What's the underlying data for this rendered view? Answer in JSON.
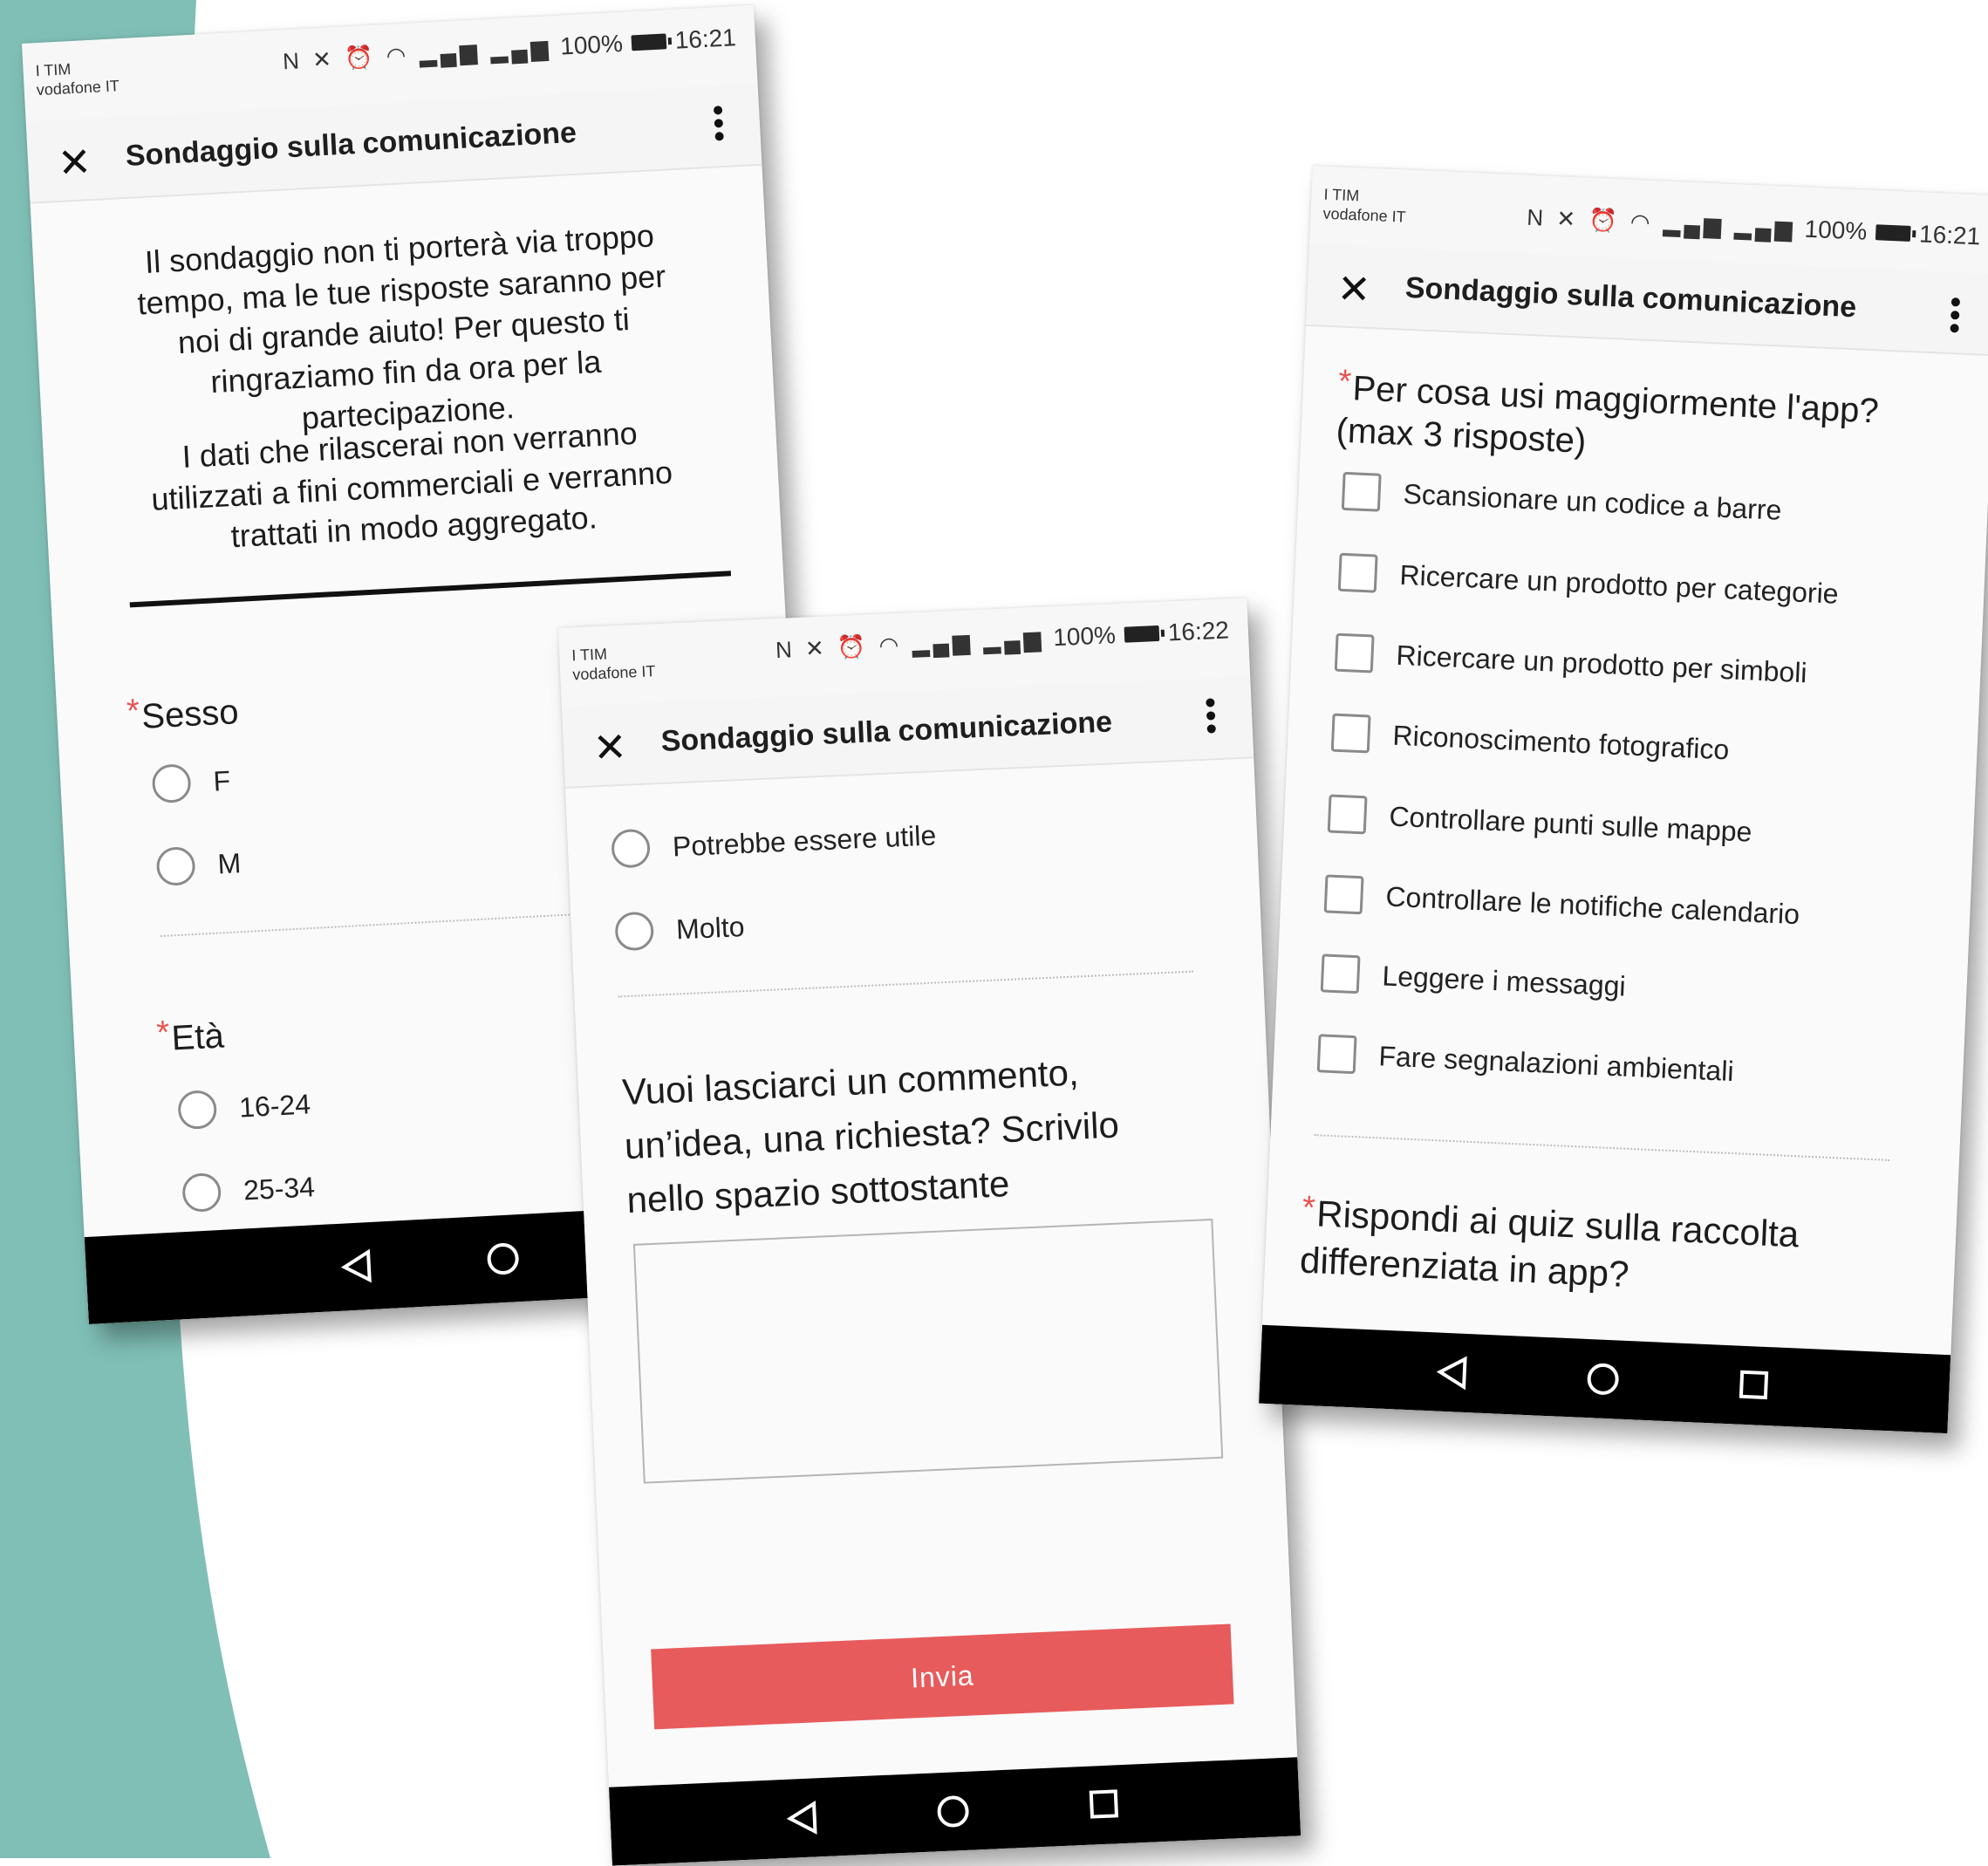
{
  "colors": {
    "teal_background": "#7fbfb6",
    "accent_red": "#e75b5c",
    "required_star": "#e8524f"
  },
  "screen1": {
    "carrier_line1": "I TIM",
    "carrier_line2": "vodafone IT",
    "battery": "100%",
    "time": "16:21",
    "title": "Sondaggio sulla comunicazione",
    "intro_p1": "Il sondaggio non ti porterà via troppo tempo, ma le tue risposte saranno per noi di grande aiuto! Per questo ti ringraziamo fin da ora per la partecipazione.",
    "intro_p2": "I dati che rilascerai non verranno utilizzati a fini commerciali e verranno trattati in modo aggregato.",
    "q1": "Sesso",
    "q1_options": [
      "F",
      "M"
    ],
    "q2": "Età",
    "q2_options": [
      "16-24",
      "25-34"
    ]
  },
  "screen2": {
    "carrier_line1": "I TIM",
    "carrier_line2": "vodafone IT",
    "battery": "100%",
    "time": "16:22",
    "title": "Sondaggio sulla comunicazione",
    "options": [
      "Potrebbe essere utile",
      "Molto"
    ],
    "comment_question": "Vuoi lasciarci un commento, un’idea, una richiesta? Scrivilo nello spazio sottostante",
    "submit_label": "Invia"
  },
  "screen3": {
    "carrier_line1": "I TIM",
    "carrier_line2": "vodafone IT",
    "battery": "100%",
    "time": "16:21",
    "title": "Sondaggio sulla comunicazione",
    "q_usage": "Per cosa usi maggiormente l'app? (max 3 risposte)",
    "usage_options": [
      "Scansionare un codice a barre",
      "Ricercare un prodotto per categorie",
      "Ricercare un prodotto per simboli",
      "Riconoscimento fotografico",
      "Controllare punti sulle mappe",
      "Controllare le notifiche calendario",
      "Leggere i messaggi",
      "Fare segnalazioni ambientali"
    ],
    "q_quiz": "Rispondi ai quiz sulla raccolta differenziata in app?"
  },
  "required_mark": "*"
}
